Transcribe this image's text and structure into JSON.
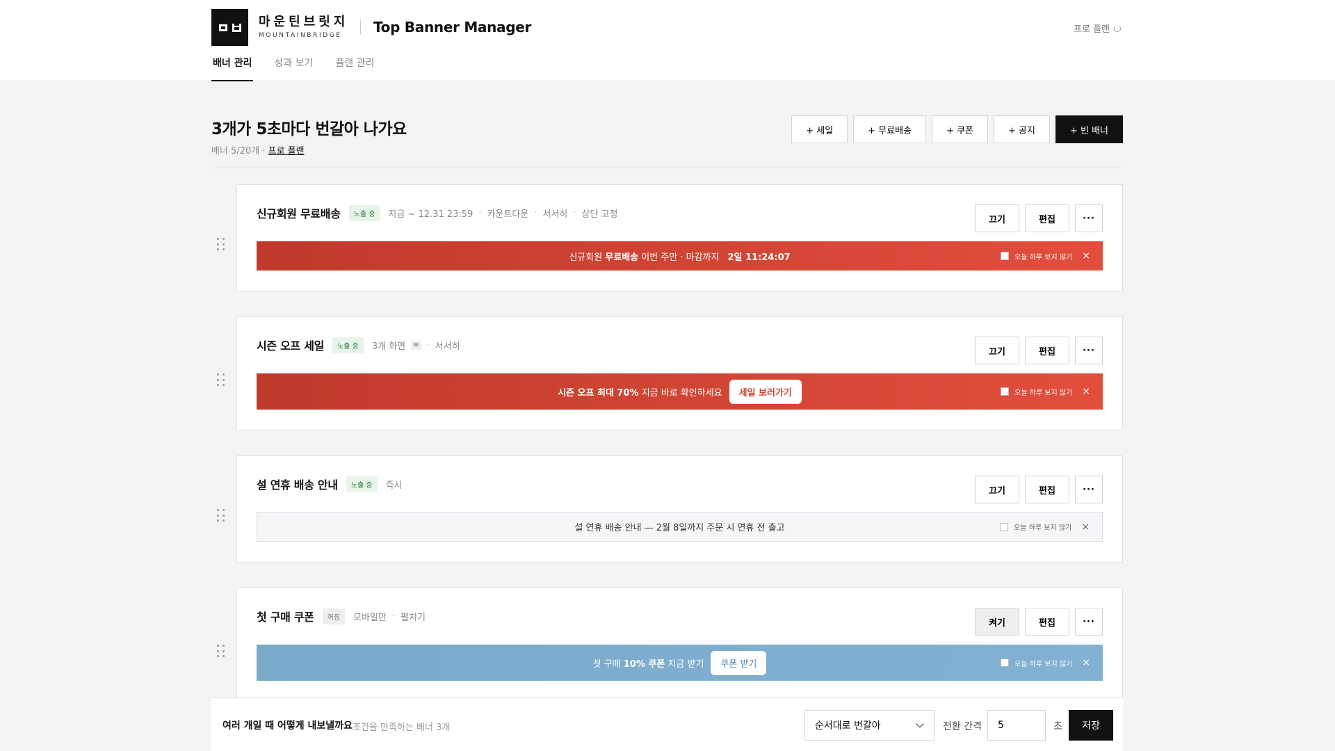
{
  "brand": {
    "name_ko": "마운틴브릿지",
    "name_en": "MOUNTAINBRIDGE"
  },
  "app": {
    "title": "Top Banner Manager"
  },
  "header": {
    "plan_label": "프로 플랜"
  },
  "tabs": [
    {
      "label": "배너 관리",
      "active": true
    },
    {
      "label": "성과 보기",
      "active": false
    },
    {
      "label": "플랜 관리",
      "active": false
    }
  ],
  "main": {
    "headline": "3개가 5초마다 번갈아 나가요",
    "sub_count": "배너 5/20개 · ",
    "sub_plan": "프로 플랜"
  },
  "quick_actions": [
    "+ 세일",
    "+ 무료배송",
    "+ 쿠폰",
    "+ 공지",
    "+ 빈 배너"
  ],
  "cards": [
    {
      "title": "신규회원 무료배송",
      "status": "노출 중",
      "meta": [
        "지금 ~ 12.31 23:59",
        "카운트다운",
        "서서히",
        "상단 고정"
      ],
      "actions": {
        "toggle": "끄기",
        "edit": "편집",
        "more": "···"
      },
      "banner": {
        "text_pre": "신규회원 ",
        "text_bold": "무료배송",
        "text_post": " 이번 주만 · 마감까지",
        "countdown": "2일 11:24:07",
        "dismiss": "오늘 하루 보지 않기"
      }
    },
    {
      "title": "시즌 오프 세일",
      "status": "노출 중",
      "meta": [
        "3개 화면",
        "서서히"
      ],
      "menu_icon": "≡",
      "actions": {
        "toggle": "끄기",
        "edit": "편집",
        "more": "···"
      },
      "banner": {
        "text_bold": "시즌 오프 최대 70%",
        "text_post": " 지금 바로 확인하세요",
        "cta": "세일 보러가기",
        "dismiss": "오늘 하루 보지 않기"
      }
    },
    {
      "title": "설 연휴 배송 안내",
      "status": "노출 중",
      "meta": [
        "즉시"
      ],
      "actions": {
        "toggle": "끄기",
        "edit": "편집",
        "more": "···"
      },
      "banner": {
        "text": "설 연휴 배송 안내 — 2월 8일까지 주문 시 연휴 전 출고",
        "dismiss": "오늘 하루 보지 않기"
      }
    },
    {
      "title": "첫 구매 쿠폰",
      "status": "꺼짐",
      "meta": [
        "모바일만",
        "펼치기"
      ],
      "actions": {
        "toggle": "켜기",
        "edit": "편집",
        "more": "···"
      },
      "banner": {
        "text_pre": "첫 구매 ",
        "text_bold": "10% 쿠폰",
        "text_post": " 지금 받기",
        "cta": "쿠폰 받기",
        "dismiss": "오늘 하루 보지 않기"
      }
    }
  ],
  "bottom": {
    "label": "여러 개일 때 어떻게 내보낼까요",
    "sub": "조건을 만족하는 배너 3개",
    "select_value": "순서대로 번갈아",
    "interval_label": "전환 간격",
    "interval_value": "5",
    "unit": "초",
    "save": "저장"
  },
  "colors": {
    "accent_red": "#d4412f",
    "accent_blue": "#7aa9c9",
    "primary": "#111111"
  }
}
